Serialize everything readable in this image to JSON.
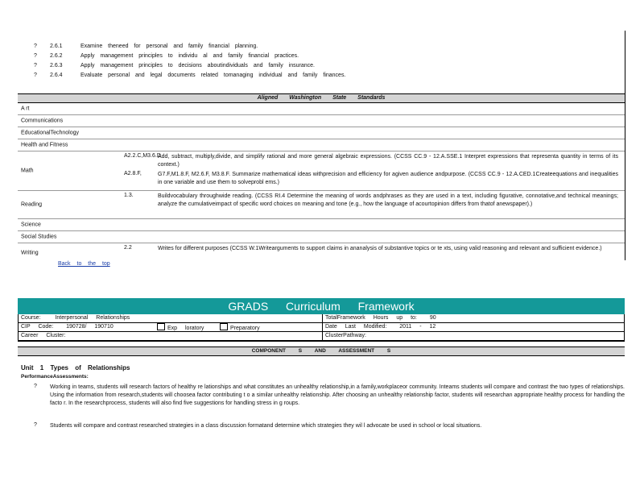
{
  "bullets": [
    {
      "mark": "?",
      "num": "2.6.1",
      "text": "Examine theneed for personal and family financial planning."
    },
    {
      "mark": "?",
      "num": "2.6.2",
      "text": "Apply management principles to individu al and family financial practices."
    },
    {
      "mark": "?",
      "num": "2.6.3",
      "text": "Apply management principles to decisions aboutindividuals and family insurance."
    },
    {
      "mark": "?",
      "num": "2.6.4",
      "text": "Evaluate personal and legal documents related tomanaging individual and family finances."
    }
  ],
  "standards": {
    "heading": "Aligned Washington State Standards",
    "rows": [
      {
        "subject": "A rt",
        "entries": []
      },
      {
        "subject": "Communications",
        "entries": []
      },
      {
        "subject": "EducationalTechnology",
        "entries": []
      },
      {
        "subject": "Health and Fitness",
        "entries": []
      },
      {
        "subject": "Math",
        "entries": [
          {
            "num": "A2.2.C,M3.6.D",
            "text": "Add, subtract, multiply,divide, and simplify rational and more general algebraic expressions. (CCSS CC.9 - 12.A.SSE.1 Interpret expressions that representa quantity in terms of its context.)"
          },
          {
            "num": "A2.8.F,",
            "text": "G7.F,M1.8.F, M2.6.F, M3.8.F. Summarize mathematical ideas withprecision and efficiency for agiven audience andpurpose. (CCSS CC.9 - 12.A.CED.1Createequations and inequalities in one variable and use them to solveprobl ems.)"
          }
        ]
      },
      {
        "subject": "Reading",
        "entries": [
          {
            "num": "1.3.",
            "text": "Buildvocabulary throughwide reading. (CCSS RI.4 Determine the meaning of words andphrases as they are used in a text, including figurative, connotative,and technical meanings; analyze the cumulativeimpact of specific word choices on meaning and tone (e.g., how the language of acourtopinion differs from thatof anewspaper).)"
          }
        ]
      },
      {
        "subject": "Science",
        "entries": []
      },
      {
        "subject": "Social Studies",
        "entries": []
      },
      {
        "subject": "Writing",
        "entries": [
          {
            "num": "2.2",
            "text": "Writes for different purposes (CCSS W.1Writearguments to support claims in ananalysis of substantive topics or te xts, using valid reasoning and relevant and sufficient evidence.)"
          }
        ]
      }
    ]
  },
  "back_link": "Back to the top",
  "grads": {
    "banner": "GRADS Curriculum Framework",
    "course_label": "Course:",
    "course_value": "Interpersonal Relationships",
    "hours_label": "TotalFramework Hours up to:",
    "hours_value": "90",
    "cip_label": "CIP Code:",
    "cip_value": "190728/ 190710",
    "exploratory": "Exp loratory",
    "preparatory": "Preparatory",
    "date_label": "Date Last Modified:",
    "date_value": "2011 - 12",
    "career_label": "Career Cluster:",
    "pathway_label": "ClusterPathway:",
    "components": "COMPONENT S AND ASSESSMENT S"
  },
  "unit": {
    "title": "Unit 1 Types of Relationships",
    "perf_label": "PerformanceAssessments:",
    "items": [
      {
        "mark": "?",
        "text": "Working in teams, students will research factors of healthy re lationships and what constitutes an unhealthy relationship,in a family,workplaceor community. Inteams students will compare and contrast the two types of relationships. Using the information from research,students will choosea factor contributing t o a similar unhealthy relationship. After choosing an unhealthy relationship factor, students will researchan appropriate healthy process for handling the facto r. In the researchprocess, students will also find five suggestions for handling stress in g roups."
      },
      {
        "mark": "?",
        "text": "Students will compare and contrast researched strategies in a class discussion formatand determine which strategies they wil l advocate be used in school or local situations."
      }
    ]
  }
}
